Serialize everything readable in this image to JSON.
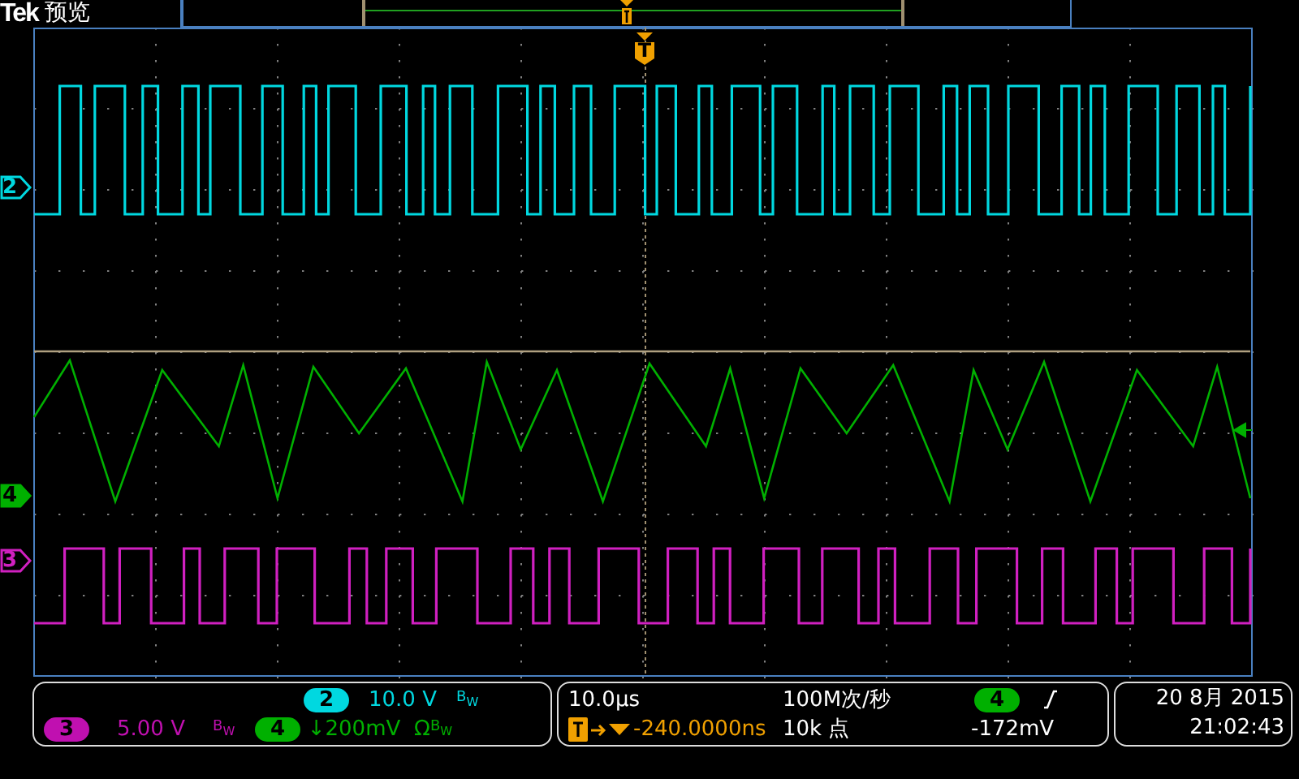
{
  "header": {
    "brand": "Tek",
    "mode": "预览"
  },
  "channel_markers": [
    {
      "label": "2",
      "color": "#00d8e0"
    },
    {
      "label": "4",
      "color": "#00b000"
    },
    {
      "label": "3",
      "color": "#d020c0"
    }
  ],
  "trigger_marker": {
    "label": "T"
  },
  "vertical_panel": {
    "top": [
      {
        "number": "2",
        "color": "#00d8e0",
        "scale": "10.0 V",
        "bandwidth": "B$_{W}$"
      }
    ],
    "bottom": [
      {
        "number": "3",
        "color": "#c010b0",
        "scale": "5.00 V",
        "bandwidth": "B$_{W}$"
      },
      {
        "number": "4",
        "color": "#00b000",
        "scale": "↓200mV",
        "termination": "Ω",
        "bandwidth": "B$_{W}$"
      }
    ]
  },
  "horizontal_panel": {
    "timebase": "10.0µs",
    "trigger_position": "-240.0000ns",
    "sample_rate": "100M次/秒",
    "record_length": "10k 点"
  },
  "trigger_panel": {
    "source": "4",
    "level": "-172mV"
  },
  "clock": {
    "date": "20 8月 2015",
    "time": "21:02:43"
  }
}
